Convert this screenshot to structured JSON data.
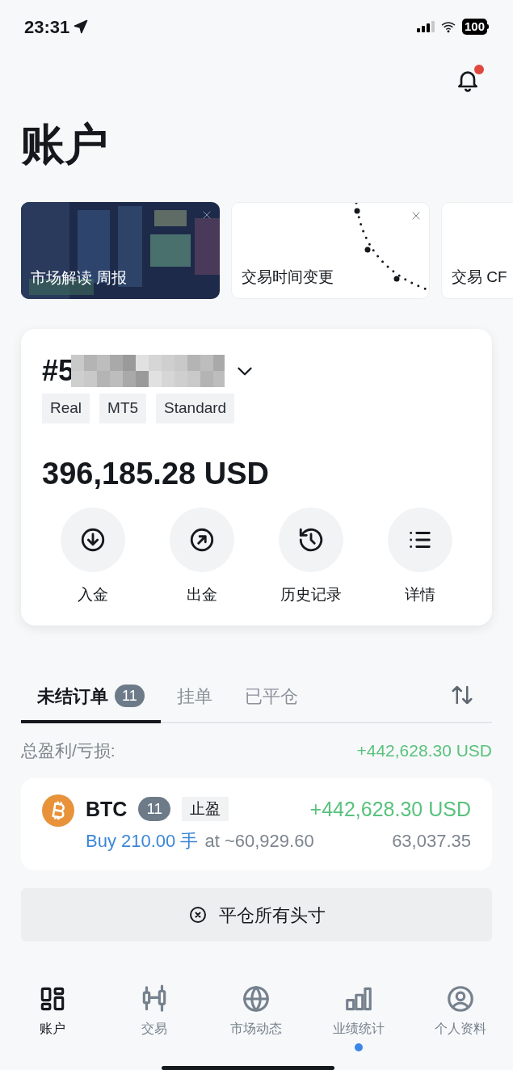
{
  "status_bar": {
    "time": "23:31",
    "battery": "100"
  },
  "notifications": {
    "unread": true
  },
  "title": "账户",
  "banners": [
    {
      "kind": "picture",
      "text": "市场解读 周报",
      "closable": true
    },
    {
      "kind": "dots",
      "text": "交易时间变更",
      "closable": true
    },
    {
      "kind": "plain",
      "text": "交易 CF"
    }
  ],
  "account": {
    "number": "#5",
    "tags": [
      "Real",
      "MT5",
      "Standard"
    ],
    "balance": "396,185.28 USD",
    "actions": [
      {
        "kind": "deposit",
        "label": "入金"
      },
      {
        "kind": "withdraw",
        "label": "出金"
      },
      {
        "kind": "history",
        "label": "历史记录"
      },
      {
        "kind": "details",
        "label": "详情"
      }
    ]
  },
  "tabs": [
    {
      "label": "未结订单",
      "count": "11",
      "selected": true
    },
    {
      "label": "挂单",
      "selected": false
    },
    {
      "label": "已平仓",
      "selected": false
    }
  ],
  "total_pnl": {
    "label": "总盈利/亏损:",
    "value": "+442,628.30 USD"
  },
  "positions": [
    {
      "symbol": "BTC",
      "count": "11",
      "tag": "止盈",
      "pnl": "+442,628.30 USD",
      "side": "Buy 210.00 手",
      "open": "at ~60,929.60",
      "price": "63,037.35"
    }
  ],
  "close_all": "平仓所有头寸",
  "nav": [
    {
      "kind": "account",
      "label": "账户",
      "selected": true,
      "dot": false
    },
    {
      "kind": "trade",
      "label": "交易",
      "selected": false,
      "dot": false
    },
    {
      "kind": "market",
      "label": "市场动态",
      "selected": false,
      "dot": false
    },
    {
      "kind": "stats",
      "label": "业绩统计",
      "selected": false,
      "dot": true
    },
    {
      "kind": "profile",
      "label": "个人资料",
      "selected": false,
      "dot": false
    }
  ]
}
